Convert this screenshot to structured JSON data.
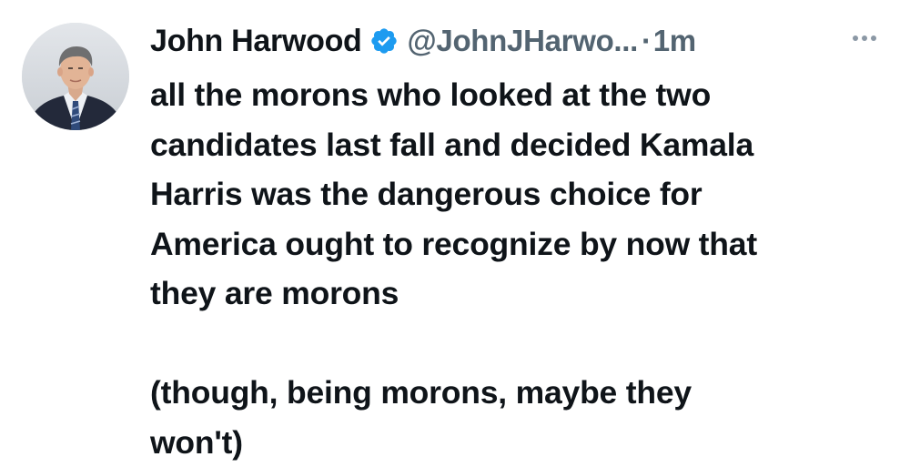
{
  "tweet": {
    "author": {
      "name": "John Harwood",
      "handle": "@JohnJHarwo...",
      "verified": true,
      "verified_color": "#1d9bf0"
    },
    "separator": "·",
    "time": "1m",
    "more_icon": "more-horizontal-icon",
    "text_lines": [
      "all the morons who looked at the two",
      "candidates last fall and decided Kamala",
      "Harris was the dangerous choice for",
      "America ought to recognize by now that",
      "they are morons",
      "",
      "(though, being morons, maybe they",
      "won't)"
    ]
  }
}
